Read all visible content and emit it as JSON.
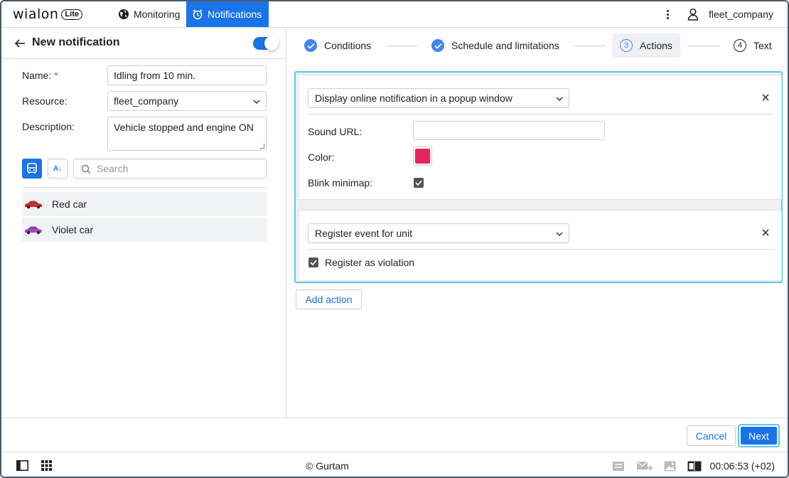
{
  "app": {
    "logo_text": "wialon",
    "logo_badge": "Lite"
  },
  "topnav": {
    "monitoring_label": "Monitoring",
    "notifications_label": "Notifications",
    "username": "fleet_company"
  },
  "left_panel": {
    "title": "New notification",
    "toggle_on": true,
    "name_label": "Name:",
    "name_required_mark": "*",
    "name_value": "Idling from 10 min.",
    "resource_label": "Resource:",
    "resource_value": "fleet_company",
    "description_label": "Description:",
    "description_value": "Vehicle stopped and engine ON",
    "sort_icon_text": "A↓",
    "search_placeholder": "Search",
    "units": [
      {
        "name": "Red car",
        "color": "#d9262c"
      },
      {
        "name": "Violet car",
        "color": "#a64ac9"
      }
    ]
  },
  "steps": [
    {
      "label": "Conditions",
      "state": "done"
    },
    {
      "label": "Schedule and limitations",
      "state": "done"
    },
    {
      "label": "Actions",
      "number": "3",
      "state": "active"
    },
    {
      "label": "Text",
      "number": "4",
      "state": "pending"
    }
  ],
  "actions": [
    {
      "type": "Display online notification in a popup window",
      "sound_url_label": "Sound URL:",
      "sound_url_value": "",
      "color_label": "Color:",
      "color_value": "#e8245f",
      "blink_minimap_label": "Blink minimap:",
      "blink_minimap_checked": true
    },
    {
      "type": "Register event for unit",
      "register_violation_label": "Register as violation",
      "register_violation_checked": true
    }
  ],
  "add_action_label": "Add action",
  "footer_buttons": {
    "cancel_label": "Cancel",
    "next_label": "Next"
  },
  "statusbar": {
    "copyright": "© Gurtam",
    "clock": "00:06:53 (+02)"
  },
  "colors": {
    "accent": "#1a73e8",
    "focus_border": "#5bc8e8"
  }
}
